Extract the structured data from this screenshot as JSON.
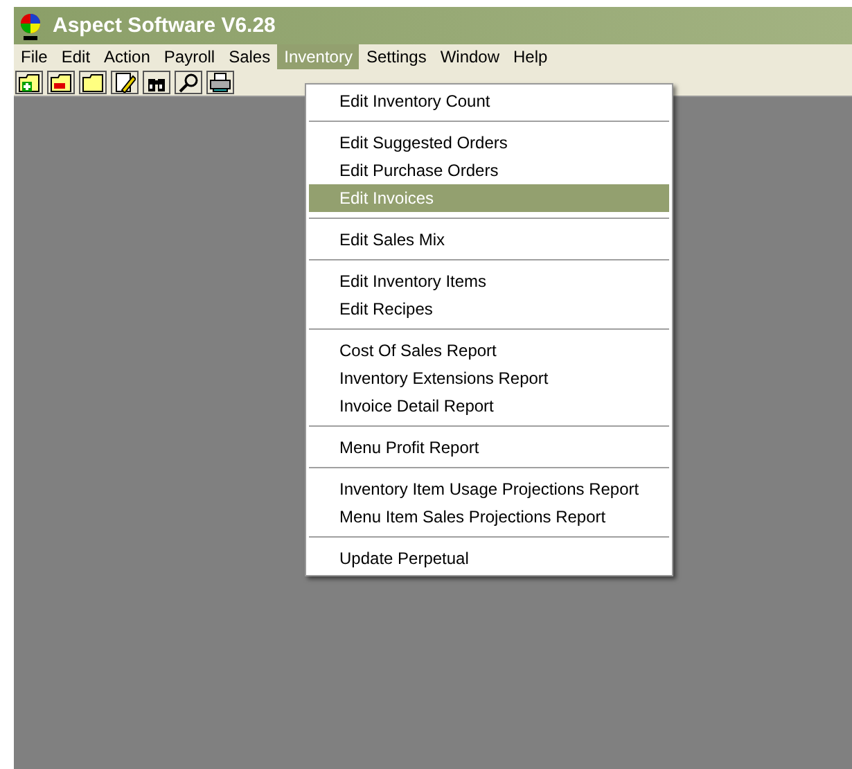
{
  "window": {
    "title": "Aspect Software V6.28"
  },
  "menu_bar": [
    {
      "label": "File",
      "selected": false
    },
    {
      "label": "Edit",
      "selected": false
    },
    {
      "label": "Action",
      "selected": false
    },
    {
      "label": "Payroll",
      "selected": false
    },
    {
      "label": "Sales",
      "selected": false
    },
    {
      "label": "Inventory",
      "selected": true
    },
    {
      "label": "Settings",
      "selected": false
    },
    {
      "label": "Window",
      "selected": false
    },
    {
      "label": "Help",
      "selected": false
    }
  ],
  "dropdown": {
    "groups": [
      [
        {
          "label": "Edit Inventory Count",
          "selected": false
        }
      ],
      [
        {
          "label": "Edit Suggested Orders",
          "selected": false
        },
        {
          "label": "Edit Purchase Orders",
          "selected": false
        },
        {
          "label": "Edit Invoices",
          "selected": true
        }
      ],
      [
        {
          "label": "Edit Sales Mix",
          "selected": false
        }
      ],
      [
        {
          "label": "Edit Inventory Items",
          "selected": false
        },
        {
          "label": "Edit Recipes",
          "selected": false
        }
      ],
      [
        {
          "label": "Cost Of Sales Report",
          "selected": false
        },
        {
          "label": "Inventory Extensions Report",
          "selected": false
        },
        {
          "label": "Invoice Detail Report",
          "selected": false
        }
      ],
      [
        {
          "label": "Menu Profit Report",
          "selected": false
        }
      ],
      [
        {
          "label": "Inventory Item Usage Projections Report",
          "selected": false
        },
        {
          "label": "Menu Item Sales Projections Report",
          "selected": false
        }
      ],
      [
        {
          "label": "Update Perpetual",
          "selected": false
        }
      ]
    ]
  }
}
